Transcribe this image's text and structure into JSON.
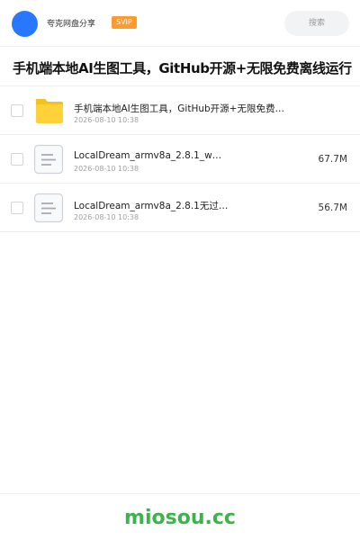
{
  "colors": {
    "avatar": "#2878ff",
    "svip": "#ff9a2e",
    "folder_back": "#f5c21c",
    "folder_front": "#ffd23a",
    "doc_border": "#cfd3d9",
    "doc_lines": "#a7adb6",
    "brand": "#3cb44b"
  },
  "header": {
    "app_name": "夸克网盘分享",
    "badge": "SVIP",
    "search_placeholder": "搜索"
  },
  "share_title": "手机端本地AI生图工具，GitHub开源+无限免费离线运行",
  "files": [
    {
      "name": "手机端本地AI生图工具，GitHub开源+无限免费…",
      "date": "2026-08-10 10:38",
      "size": "",
      "icon": "folder-icon"
    },
    {
      "name": "LocalDream_armv8a_2.8.1_w…",
      "date": "2026-08-10 10:38",
      "size": "67.7M",
      "icon": "document-icon"
    },
    {
      "name": "LocalDream_armv8a_2.8.1无过…",
      "date": "2026-08-10 10:38",
      "size": "56.7M",
      "icon": "document-icon"
    }
  ],
  "footer": {
    "brand": "miosou.cc"
  }
}
